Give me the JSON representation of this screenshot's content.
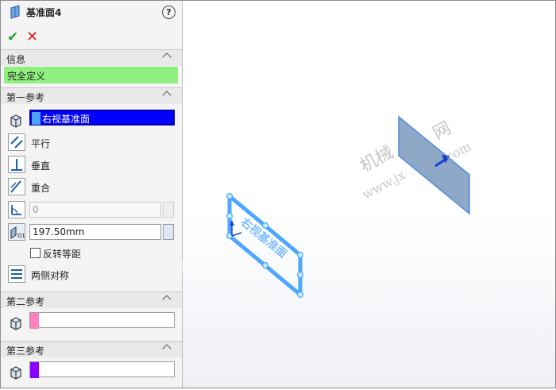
{
  "panel": {
    "title": "基准面4",
    "help_symbol": "?",
    "ok_symbol": "✔",
    "cancel_symbol": "✕"
  },
  "info": {
    "header": "信息",
    "status": "完全定义",
    "status_color": "#8ff07f"
  },
  "ref1": {
    "header": "第一参考",
    "selection": "右视基准面",
    "swatch_color": "#4aa3ff",
    "options": {
      "parallel": "平行",
      "perpendicular": "垂直",
      "coincident": "重合"
    },
    "angle_value": "0",
    "distance_value": "197.50mm",
    "flip_offset": "反转等距",
    "flip_checked": false,
    "mid_plane": "两侧对称"
  },
  "ref2": {
    "header": "第二参考",
    "swatch_color": "#ff7fbf"
  },
  "ref3": {
    "header": "第三参考",
    "swatch_color": "#8a00ff"
  },
  "viewport": {
    "plane_label": "右视基准面",
    "watermark_line1": "机械",
    "watermark_line2": "网",
    "watermark_line3": "www.jx",
    "watermark_line4": ".com",
    "plane_color": "#4da6ff",
    "preview_plane_color": "#8fa8c8"
  }
}
